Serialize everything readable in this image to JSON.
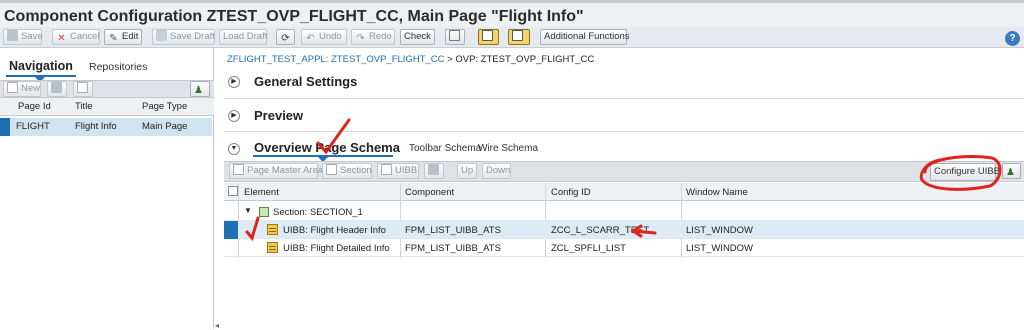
{
  "window": {
    "title": "Component Configuration ZTEST_OVP_FLIGHT_CC, Main Page \"Flight Info\""
  },
  "toolbar": {
    "save": "Save",
    "cancel": "Cancel",
    "edit": "Edit",
    "save_draft": "Save Draft",
    "load_draft": "Load Draft",
    "undo": "Undo",
    "redo": "Redo",
    "check": "Check",
    "additional_functions": "Additional Functions",
    "help": "?"
  },
  "navigation": {
    "tab_navigation": "Navigation",
    "tab_repositories": "Repositories",
    "new_button": "New",
    "columns": [
      "Page Id",
      "Title",
      "Page Type"
    ],
    "rows": [
      {
        "page_id": "FLIGHT",
        "title": "Flight Info",
        "page_type": "Main Page"
      }
    ]
  },
  "breadcrumb": {
    "link": "ZFLIGHT_TEST_APPL: ZTEST_OVP_FLIGHT_CC",
    "separator": ">",
    "current": "OVP: ZTEST_OVP_FLIGHT_CC"
  },
  "sections": {
    "general": "General Settings",
    "preview": "Preview",
    "overview": "Overview Page Schema"
  },
  "schema_tabs": {
    "toolbar": "Toolbar Schema",
    "wire": "Wire Schema"
  },
  "schema_toolbar": {
    "page_master_area": "Page Master Area",
    "section": "Section",
    "uibb": "UIBB",
    "up": "Up",
    "down": "Down",
    "configure_uibb": "Configure UIBB"
  },
  "table": {
    "columns": [
      "Element",
      "Component",
      "Config ID",
      "Window Name"
    ],
    "section_row": "Section: SECTION_1",
    "rows": [
      {
        "element": "UIBB: Flight Header Info",
        "component": "FPM_LIST_UIBB_ATS",
        "config_id": "ZCC_L_SCARR_TEST",
        "window": "LIST_WINDOW"
      },
      {
        "element": "UIBB: Flight Detailed Info",
        "component": "FPM_LIST_UIBB_ATS",
        "config_id": "ZCL_SPFLI_LIST",
        "window": "LIST_WINDOW"
      }
    ]
  }
}
